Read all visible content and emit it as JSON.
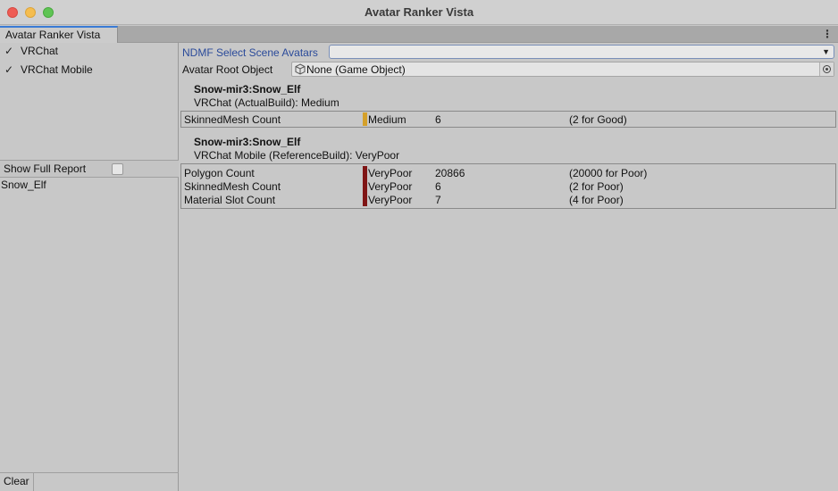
{
  "window": {
    "title": "Avatar Ranker Vista"
  },
  "tab": {
    "label": "Avatar Ranker Vista"
  },
  "colors": {
    "medium": "#d4a02a",
    "verypoor": "#7f1515",
    "accent_blue": "#2a4a9a"
  },
  "platforms": [
    {
      "label": "VRChat",
      "checked": true
    },
    {
      "label": "VRChat Mobile",
      "checked": true
    }
  ],
  "show_full_report": {
    "label": "Show Full Report",
    "checked": false
  },
  "avatar_list": [
    "Snow_Elf"
  ],
  "clear_button": "Clear",
  "ndmf": {
    "label": "NDMF Select Scene Avatars",
    "value": ""
  },
  "root_object": {
    "label": "Avatar Root Object",
    "value": "None (Game Object)"
  },
  "reports": [
    {
      "name": "Snow-mir3:Snow_Elf",
      "subtitle": "VRChat (ActualBuild): Medium",
      "rows": [
        {
          "name": "SkinnedMesh Count",
          "level": "Medium",
          "value": "6",
          "threshold": "(2 for Good)"
        }
      ]
    },
    {
      "name": "Snow-mir3:Snow_Elf",
      "subtitle": "VRChat Mobile (ReferenceBuild): VeryPoor",
      "rows": [
        {
          "name": "Polygon Count",
          "level": "VeryPoor",
          "value": "20866",
          "threshold": "(20000 for Poor)"
        },
        {
          "name": "SkinnedMesh Count",
          "level": "VeryPoor",
          "value": "6",
          "threshold": "(2 for Poor)"
        },
        {
          "name": "Material Slot Count",
          "level": "VeryPoor",
          "value": "7",
          "threshold": "(4 for Poor)"
        }
      ]
    }
  ]
}
